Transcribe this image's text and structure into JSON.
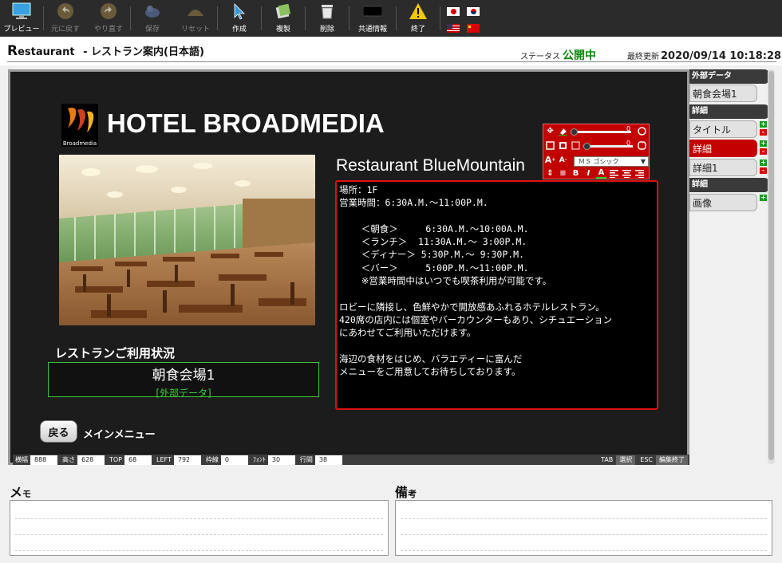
{
  "toolbar": {
    "preview": "プレビュー",
    "undo": "元に戻す",
    "redo": "やり直す",
    "save": "保存",
    "reset": "リセット",
    "create": "作成",
    "duplicate": "複製",
    "delete": "削除",
    "shared_info": "共通情報",
    "exit": "終了"
  },
  "header": {
    "title_first": "R",
    "title_rest": "estaurant",
    "subtitle": "- レストラン案内(日本語)",
    "status_label": "ステータス",
    "status_value": "公開中",
    "updated_label": "最終更新",
    "updated_value": "2020/09/14 10:18:28"
  },
  "colors": {
    "accent": "#c40000",
    "status": "#0a8a0a",
    "external": "#39d139"
  },
  "stage": {
    "logo_caption": "Broadmedia",
    "hotel_name": "HOTEL BROADMEDIA",
    "restaurant_title": "Restaurant BlueMountain",
    "detail_text": "場所：1F\n営業時間：6:30A.M.～11:00P.M.\n\n    ＜朝食＞     6:30A.M.～10:00A.M.\n    ＜ランチ＞  11:30A.M.～ 3:00P.M.\n    ＜ディナー＞ 5:30P.M.～ 9:30P.M.\n    ＜バー＞     5:00P.M.～11:00P.M.\n    ※営業時間中はいつでも喫茶利用が可能です。\n\nロビーに隣接し、色鮮やかで開放感あふれるホテルレストラン。\n420席の店内には個室やバーカウンターもあり、シチュエーション\nにあわせてご利用いただけます。\n\n海辺の食材をはじめ、バラエティーに富んだ\nメニューをご用意してお待ちしております。",
    "usage_label": "レストランご利用状況",
    "usage_name": "朝食会場1",
    "usage_external": "[外部データ]",
    "back_button": "戻る",
    "back_label": "メインメニュー",
    "font_select": "ＭＳ ゴシック",
    "slider1_value": "0",
    "slider2_value": "0"
  },
  "infobar": {
    "width_label": "横幅",
    "width": "888",
    "height_label": "高さ",
    "height": "628",
    "top_label": "TOP",
    "top": "68",
    "left_label": "LEFT",
    "left": "792",
    "border_label": "枠線",
    "border": "0",
    "font_label": "ﾌｫﾝﾄ",
    "font": "30",
    "line_label": "行間",
    "line": "38",
    "tab_key": "TAB",
    "tab_action": "選択",
    "esc_key": "ESC",
    "esc_action": "編集終了"
  },
  "right_panel": {
    "section_external": "外部データ",
    "external_item": "朝食会場1",
    "section_detail1": "詳細",
    "items": [
      "タイトル",
      "詳細",
      "詳細1"
    ],
    "section_detail2": "詳細",
    "image_item": "画像"
  },
  "memo": {
    "memo_big": "メ",
    "memo_small": "モ",
    "note_big": "備",
    "note_small": "考"
  }
}
